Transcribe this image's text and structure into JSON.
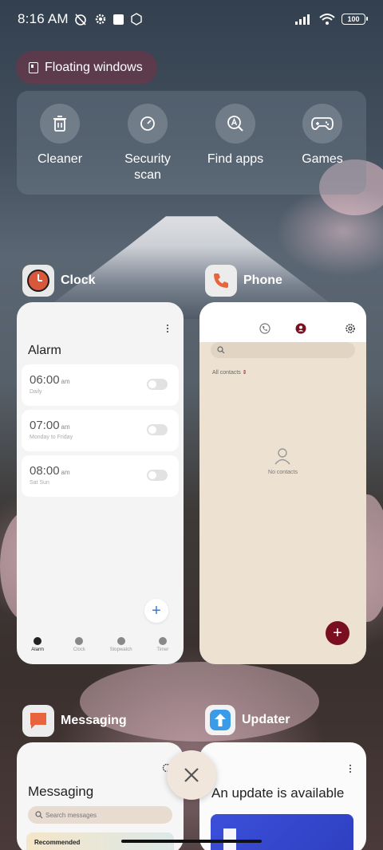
{
  "status_bar": {
    "time": "8:16 AM",
    "battery": "100"
  },
  "floating_windows": {
    "label": "Floating windows"
  },
  "quick_actions": [
    {
      "label": "Cleaner",
      "icon": "trash-icon"
    },
    {
      "label": "Security\nscan",
      "icon": "security-scan-icon"
    },
    {
      "label": "Find apps",
      "icon": "find-apps-icon"
    },
    {
      "label": "Games",
      "icon": "gamepad-icon"
    }
  ],
  "apps": {
    "clock": {
      "name": "Clock",
      "title": "Alarm",
      "alarms": [
        {
          "time": "06:00",
          "ampm": "am",
          "repeat": "Daily"
        },
        {
          "time": "07:00",
          "ampm": "am",
          "repeat": "Monday to Friday"
        },
        {
          "time": "08:00",
          "ampm": "am",
          "repeat": "Sat Sun"
        }
      ],
      "tabs": [
        "Alarm",
        "Clock",
        "Stopwatch",
        "Timer"
      ]
    },
    "phone": {
      "name": "Phone",
      "filter": "All contacts",
      "empty": "No contacts"
    },
    "messaging": {
      "name": "Messaging",
      "title": "Messaging",
      "search_placeholder": "Search messages",
      "recommended": "Recommended"
    },
    "updater": {
      "name": "Updater",
      "title": "An update is available"
    }
  },
  "colors": {
    "clock_icon_bg": "#d9573a",
    "phone_accent": "#7a0f22",
    "messaging_icon_bg": "#e8643c",
    "updater_icon_bg": "#3a9ce8",
    "clock_fab": "#2a7de1"
  }
}
